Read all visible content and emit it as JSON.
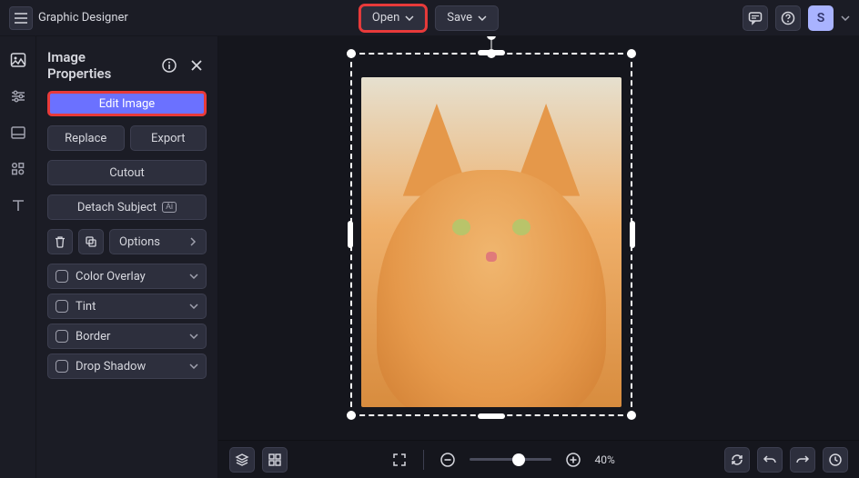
{
  "header": {
    "app_title": "Graphic Designer",
    "open_label": "Open",
    "save_label": "Save",
    "avatar_initial": "S"
  },
  "rail": {
    "items": [
      {
        "name": "image-tool-icon"
      },
      {
        "name": "adjust-tool-icon"
      },
      {
        "name": "presets-tool-icon"
      },
      {
        "name": "grid-tool-icon"
      },
      {
        "name": "text-tool-icon"
      }
    ]
  },
  "panel": {
    "title": "Image Properties",
    "edit_image": "Edit Image",
    "replace": "Replace",
    "export": "Export",
    "cutout": "Cutout",
    "detach_subject": "Detach Subject",
    "ai_badge": "Ai",
    "options": "Options",
    "props": [
      {
        "label": "Color Overlay"
      },
      {
        "label": "Tint"
      },
      {
        "label": "Border"
      },
      {
        "label": "Drop Shadow"
      }
    ]
  },
  "bottom": {
    "zoom_label": "40%"
  },
  "canvas": {
    "selected_object": "image"
  }
}
